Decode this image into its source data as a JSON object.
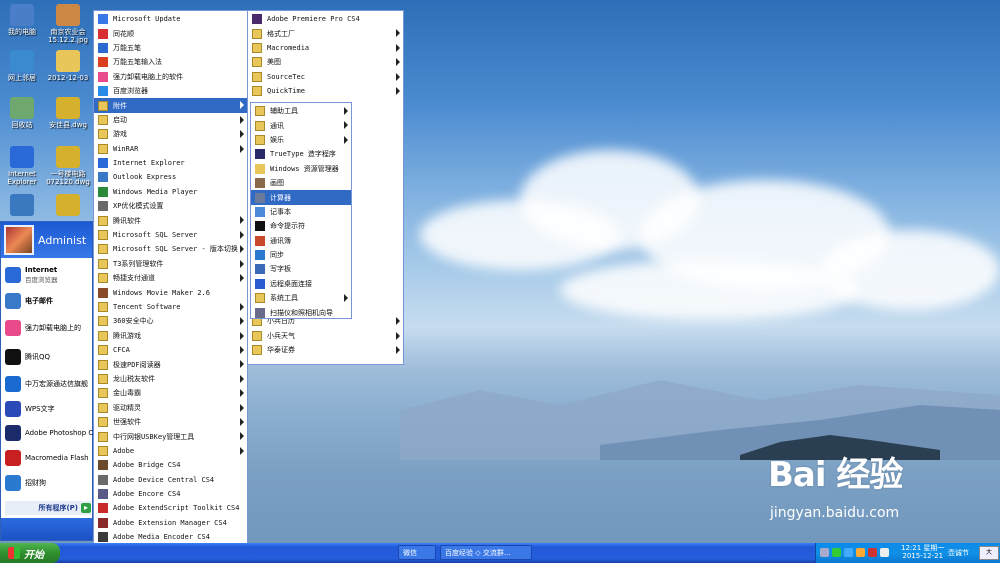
{
  "desktop": {
    "icons": [
      {
        "label": "我的电脑",
        "color": "#4a7ec8"
      },
      {
        "label": "南京农业会 15.12.2.jpg",
        "color": "#c84"
      },
      {
        "label": "网上邻居",
        "color": "#3a8ad0"
      },
      {
        "label": "2012-12-03",
        "color": "#e8c65a"
      },
      {
        "label": "回收站",
        "color": "#6fa86f"
      },
      {
        "label": "安佳县.dwg",
        "color": "#d4b02c"
      },
      {
        "label": "Internet Explorer",
        "color": "#2a6ad8"
      },
      {
        "label": "一号楼电路 072120.dwg",
        "color": "#d4b02c"
      },
      {
        "label": "",
        "color": "#3a78c0"
      },
      {
        "label": "",
        "color": "#d4b02c"
      }
    ]
  },
  "start_panel": {
    "user": "Administ",
    "pinned": [
      {
        "title": "Internet",
        "subtitle": "百度浏览器",
        "color": "#2a6ad8"
      },
      {
        "title": "电子邮件",
        "subtitle": "",
        "color": "#3a78c8"
      }
    ],
    "recent": [
      {
        "label": "强力卸载电脑上的",
        "color": "#e84a8a"
      },
      {
        "label": "腾讯QQ",
        "color": "#111"
      },
      {
        "label": "中万宏源通达信旗舰",
        "color": "#1a6ad0"
      },
      {
        "label": "WPS文字",
        "color": "#2a4ab8"
      },
      {
        "label": "Adobe Photoshop C",
        "color": "#1a2a6a"
      },
      {
        "label": "Macromedia Flash",
        "color": "#c82020"
      },
      {
        "label": "招财狗",
        "color": "#2a7ad0"
      }
    ],
    "all_programs": "所有程序(P)"
  },
  "menu1": {
    "items": [
      {
        "label": "Microsoft Update",
        "arrow": false,
        "color": "#3a78e8"
      },
      {
        "label": "同花顺",
        "arrow": false,
        "color": "#d83030"
      },
      {
        "label": "万能五笔",
        "arrow": false,
        "color": "#2a6ad0"
      },
      {
        "label": "万能五笔输入法",
        "arrow": false,
        "color": "#d84020"
      },
      {
        "label": "强力卸载电脑上的软件",
        "arrow": false,
        "color": "#e84a8a"
      },
      {
        "label": "百度浏览器",
        "arrow": false,
        "color": "#2a8ae8"
      },
      {
        "label": "附件",
        "arrow": true,
        "folder": true,
        "selected": true
      },
      {
        "label": "启动",
        "arrow": true,
        "folder": true
      },
      {
        "label": "游戏",
        "arrow": true,
        "folder": true
      },
      {
        "label": "WinRAR",
        "arrow": true,
        "folder": true
      },
      {
        "label": "Internet Explorer",
        "arrow": false,
        "color": "#2a6ad8"
      },
      {
        "label": "Outlook Express",
        "arrow": false,
        "color": "#3a78c8"
      },
      {
        "label": "Windows Media Player",
        "arrow": false,
        "color": "#2a8a3a"
      },
      {
        "label": "XP优化模式设置",
        "arrow": false,
        "color": "#6a6a6a"
      },
      {
        "label": "腾讯软件",
        "arrow": true,
        "folder": true
      },
      {
        "label": "Microsoft SQL Server",
        "arrow": true,
        "folder": true
      },
      {
        "label": "Microsoft SQL Server - 版本切换",
        "arrow": true,
        "folder": true
      },
      {
        "label": "T3系列管理软件",
        "arrow": true,
        "folder": true
      },
      {
        "label": "畅捷支付通道",
        "arrow": true,
        "folder": true
      },
      {
        "label": "Windows Movie Maker 2.6",
        "arrow": false,
        "color": "#8a4a2a"
      },
      {
        "label": "Tencent Software",
        "arrow": true,
        "folder": true
      },
      {
        "label": "360安全中心",
        "arrow": true,
        "folder": true
      },
      {
        "label": "腾讯游戏",
        "arrow": true,
        "folder": true
      },
      {
        "label": "CFCA",
        "arrow": true,
        "folder": true
      },
      {
        "label": "极速PDF阅读器",
        "arrow": true,
        "folder": true
      },
      {
        "label": "龙山税友软件",
        "arrow": true,
        "folder": true
      },
      {
        "label": "金山毒霸",
        "arrow": true,
        "folder": true
      },
      {
        "label": "驱动精灵",
        "arrow": true,
        "folder": true
      },
      {
        "label": "世强软件",
        "arrow": true,
        "folder": true
      },
      {
        "label": "中行网银USBKey管理工具",
        "arrow": true,
        "folder": true
      },
      {
        "label": "Adobe",
        "arrow": true,
        "folder": true
      },
      {
        "label": "Adobe Bridge CS4",
        "arrow": false,
        "color": "#6a4a2a"
      },
      {
        "label": "Adobe Device Central CS4",
        "arrow": false,
        "color": "#6a6a6a"
      },
      {
        "label": "Adobe Encore CS4",
        "arrow": false,
        "color": "#5a5a8a"
      },
      {
        "label": "Adobe ExtendScript Toolkit CS4",
        "arrow": false,
        "color": "#c82a2a"
      },
      {
        "label": "Adobe Extension Manager CS4",
        "arrow": false,
        "color": "#8a2a2a"
      },
      {
        "label": "Adobe Media Encoder CS4",
        "arrow": false,
        "color": "#3a3a3a"
      },
      {
        "label": "Adobe OnLocation CS4",
        "arrow": false,
        "color": "#3a5a8a"
      }
    ]
  },
  "menu2": {
    "items": [
      {
        "label": "Adobe Premiere Pro CS4",
        "arrow": false,
        "color": "#4a2a6a"
      },
      {
        "label": "格式工厂",
        "arrow": true,
        "folder": true
      },
      {
        "label": "Macromedia",
        "arrow": true,
        "folder": true
      },
      {
        "label": "美图",
        "arrow": true,
        "folder": true
      },
      {
        "label": "SourceTec",
        "arrow": true,
        "folder": true
      },
      {
        "label": "QuickTime",
        "arrow": true,
        "folder": true
      },
      {
        "label": "",
        "arrow": false,
        "folder": false,
        "hidden": true
      },
      {
        "label": "",
        "arrow": true,
        "hidden": true
      },
      {
        "label": "",
        "arrow": true,
        "hidden": true
      },
      {
        "label": "",
        "arrow": true,
        "hidden": true
      },
      {
        "label": "",
        "arrow": true,
        "hidden": true
      },
      {
        "label": "",
        "arrow": true,
        "hidden": true
      },
      {
        "label": "",
        "arrow": true,
        "hidden": true
      },
      {
        "label": "",
        "arrow": true,
        "hidden": true
      },
      {
        "label": "",
        "arrow": true,
        "hidden": true
      },
      {
        "label": "",
        "arrow": true,
        "hidden": true
      },
      {
        "label": "",
        "arrow": true,
        "hidden": true
      },
      {
        "label": "",
        "arrow": true,
        "hidden": true
      },
      {
        "label": "",
        "arrow": true,
        "hidden": true
      },
      {
        "label": "",
        "arrow": true,
        "hidden": true
      },
      {
        "label": "",
        "arrow": true,
        "hidden": true
      },
      {
        "label": "小兵日历",
        "arrow": true,
        "folder": true
      },
      {
        "label": "小兵天气",
        "arrow": true,
        "folder": true
      },
      {
        "label": "华泰证券",
        "arrow": true,
        "folder": true
      }
    ]
  },
  "menu3": {
    "items": [
      {
        "label": "辅助工具",
        "arrow": true,
        "folder": true
      },
      {
        "label": "通讯",
        "arrow": true,
        "folder": true
      },
      {
        "label": "娱乐",
        "arrow": true,
        "folder": true
      },
      {
        "label": "TrueType 造字程序",
        "arrow": false,
        "color": "#2a2a6a"
      },
      {
        "label": "Windows 资源管理器",
        "arrow": false,
        "color": "#e8c65a"
      },
      {
        "label": "画图",
        "arrow": false,
        "color": "#8a6a4a"
      },
      {
        "label": "计算器",
        "arrow": false,
        "color": "#6a7a9a",
        "selected": true
      },
      {
        "label": "记事本",
        "arrow": false,
        "color": "#4a8ad8"
      },
      {
        "label": "命令提示符",
        "arrow": false,
        "color": "#111"
      },
      {
        "label": "通讯簿",
        "arrow": false,
        "color": "#c84a2a"
      },
      {
        "label": "同步",
        "arrow": false,
        "color": "#2a7ad0"
      },
      {
        "label": "写字板",
        "arrow": false,
        "color": "#3a6ab8"
      },
      {
        "label": "远程桌面连接",
        "arrow": false,
        "color": "#2a5ad0"
      },
      {
        "label": "系统工具",
        "arrow": true,
        "folder": true
      },
      {
        "label": "扫描仪和照相机向导",
        "arrow": false,
        "color": "#6a6a8a"
      }
    ]
  },
  "taskbar": {
    "start_label": "开始",
    "tasks": [
      "微信",
      "百度经验 ◇ 交流群..."
    ],
    "time": "12:21 星期一",
    "date": "2015-12-21",
    "ime": "壶诚节",
    "lang": "大"
  },
  "watermark": {
    "logo": "Bai 经验",
    "url": "jingyan.baidu.com"
  }
}
